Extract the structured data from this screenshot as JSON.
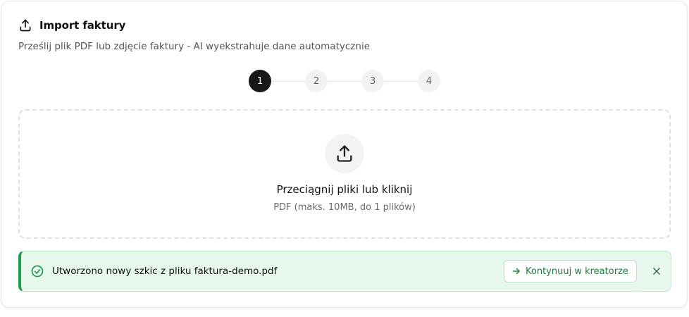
{
  "import": {
    "title": "Import faktury",
    "subtitle": "Prześlij plik PDF lub zdjęcie faktury - AI wyekstrahuje dane automatycznie",
    "header_icon": "upload-icon"
  },
  "stepper": {
    "current": 1,
    "steps": [
      "1",
      "2",
      "3",
      "4"
    ]
  },
  "dropzone": {
    "title": "Przeciągnij pliki lub kliknij",
    "hint": "PDF (maks. 10MB, do 1 plików)",
    "icon": "upload-icon"
  },
  "alert": {
    "message": "Utworzono nowy szkic z pliku faktura-demo.pdf",
    "continue_label": "Kontynuuj w kreatorze",
    "status_icon": "check-circle-icon",
    "close_icon": "close-icon"
  },
  "colors": {
    "success": "#1f9a4b",
    "success_bg": "#e7f7ec",
    "active_step": "#171717"
  }
}
